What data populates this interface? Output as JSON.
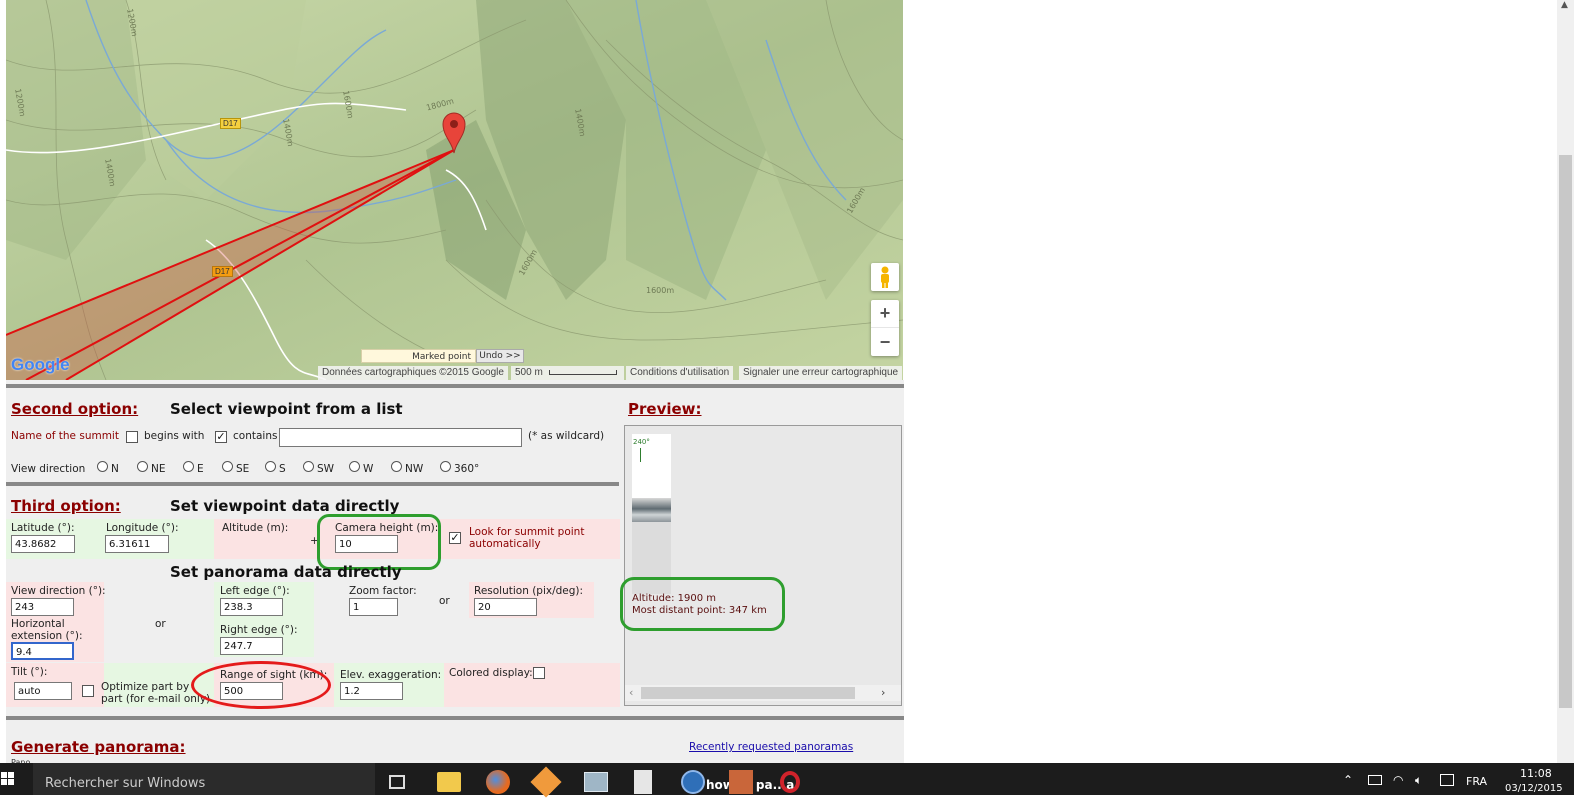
{
  "map": {
    "road_labels": [
      "D17",
      "D17"
    ],
    "contour_labels": [
      "1200m",
      "1800m",
      "1600m",
      "1400m",
      "1400m",
      "1600m",
      "1400m",
      "1600m",
      "1200m",
      "1600m"
    ],
    "marked_point_label": "Marked point",
    "undo_label": "Undo >>",
    "attribution": "Données cartographiques ©2015 Google",
    "scale": "500 m",
    "terms": "Conditions d'utilisation",
    "report": "Signaler une erreur cartographique",
    "google_logo": "Google",
    "zoom_in": "+",
    "zoom_out": "−"
  },
  "second_option": {
    "title": "Second option:",
    "subtitle": "Select viewpoint from a list",
    "summit_label": "Name of the summit",
    "begins_with": "begins with",
    "contains": "contains",
    "contains_checked": true,
    "wildcard_note": "(* as wildcard)",
    "search_value": "",
    "view_direction_label": "View direction",
    "directions": [
      "N",
      "NE",
      "E",
      "SE",
      "S",
      "SW",
      "W",
      "NW",
      "360°"
    ]
  },
  "third_option": {
    "title": "Third option:",
    "subtitle": "Set viewpoint data directly",
    "latitude_label": "Latitude (°):",
    "latitude_value": "43.8682",
    "longitude_label": "Longitude (°):",
    "longitude_value": "6.31611",
    "altitude_label": "Altitude (m):",
    "plus_sign": "+",
    "camera_height_label": "Camera height (m):",
    "camera_height_value": "10",
    "summit_auto_label": "Look for summit point automatically",
    "summit_auto_checked": true
  },
  "panorama": {
    "subtitle": "Set panorama data directly",
    "view_direction_label": "View direction (°):",
    "view_direction_value": "243",
    "horizontal_label": "Horizontal extension (°):",
    "horizontal_value": "9.4",
    "or1": "or",
    "left_edge_label": "Left edge (°):",
    "left_edge_value": "238.3",
    "right_edge_label": "Right edge (°):",
    "right_edge_value": "247.7",
    "zoom_label": "Zoom factor:",
    "zoom_value": "1",
    "or2": "or",
    "resolution_label": "Resolution (pix/deg):",
    "resolution_value": "20",
    "tilt_label": "Tilt (°):",
    "tilt_value": "auto",
    "optimize_label": "Optimize part by part (for e-mail only)",
    "range_label": "Range of sight (km):",
    "range_value": "500",
    "elev_label": "Elev. exaggeration:",
    "elev_value": "1.2",
    "colored_label": "Colored display:"
  },
  "preview": {
    "title": "Preview:",
    "angle_label": "240°",
    "altitude_text": "Altitude: 1900 m",
    "distant_text": "Most distant point: 347 km"
  },
  "generate": {
    "title": "Generate panorama:",
    "recent_link": "Recently requested panoramas",
    "peek_text": "Pano"
  },
  "taskbar": {
    "search_placeholder": "Rechercher sur Windows",
    "language": "FRA",
    "time": "11:08",
    "date": "03/12/2015",
    "overlap_text": "how ... pa...a"
  }
}
